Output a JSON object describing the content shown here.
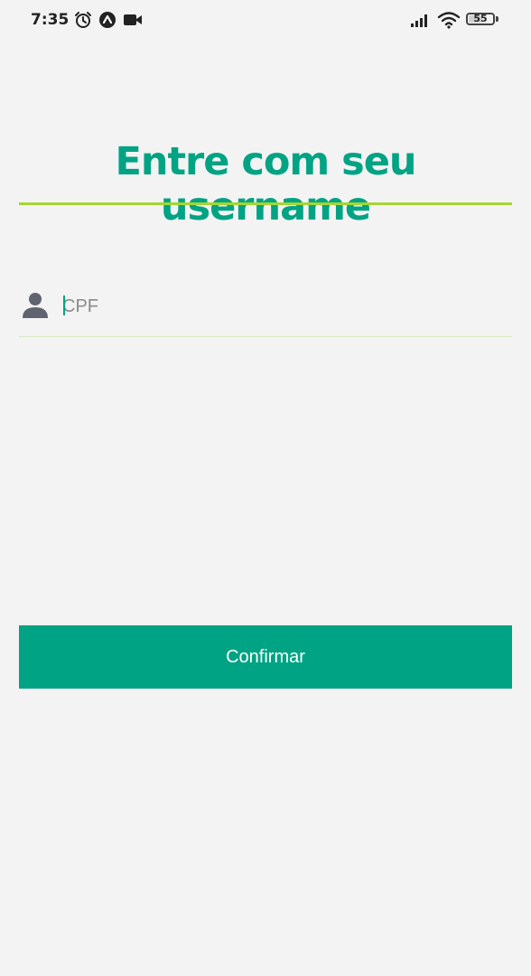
{
  "status_bar": {
    "time": "7:35",
    "battery_level": "55",
    "icons": [
      "alarm-icon",
      "app-notification-icon",
      "video-camera-icon",
      "signal-icon",
      "wifi-icon",
      "battery-icon"
    ]
  },
  "login": {
    "title": "Entre com seu username",
    "cpf_placeholder": "CPF",
    "cpf_value": "",
    "confirm_label": "Confirmar"
  },
  "colors": {
    "primary": "#00a383",
    "accent_line": "#a6d530",
    "background": "#f3f3f3",
    "icon_gray": "#5f6470"
  }
}
